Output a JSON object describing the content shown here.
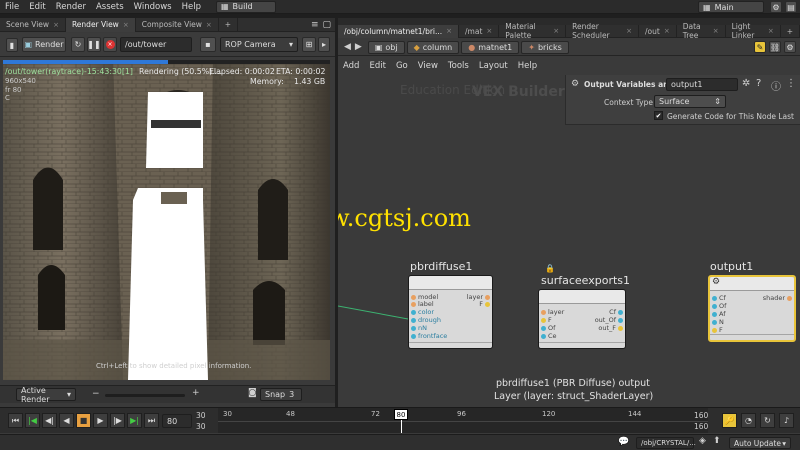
{
  "menubar": {
    "items": [
      "File",
      "Edit",
      "Render",
      "Assets",
      "Windows",
      "Help"
    ],
    "desktop_label": "Build",
    "desktop_right_label": "Main"
  },
  "left_tabs": [
    "Scene View",
    "Render View",
    "Composite View"
  ],
  "render_toolbar": {
    "render_label": "Render",
    "output_path": "/out/tower",
    "camera_label": "ROP Camera"
  },
  "render_info": {
    "node": "/out/tower(raytrace)-15:43:30[1]",
    "status": "Rendering (50.5%)....",
    "elapsed": "Elapsed: 0:00:02",
    "eta": "ETA: 0:00:02",
    "resolution": "960x540",
    "memory_label": "Memory:",
    "memory_value": "1.43 GB",
    "frame": "fr 80",
    "channel": "C",
    "hint": "Ctrl+Left to show detailed pixel information.",
    "progress": 0.505
  },
  "left_bottom": {
    "active_render": "Active Render",
    "snap_label": "Snap",
    "snap_value": "3"
  },
  "right_tabs": [
    "/obj/column/matnet1/bri...",
    "/mat",
    "Material Palette",
    "Render Scheduler",
    "/out",
    "Data Tree",
    "Light Linker"
  ],
  "path_bar": [
    "obj",
    "column",
    "matnet1",
    "bricks"
  ],
  "net_menu": [
    "Add",
    "Edit",
    "Go",
    "View",
    "Tools",
    "Layout",
    "Help"
  ],
  "network": {
    "watermark_edu": "Education Edition",
    "watermark_vex": "VEX Builder",
    "site_watermark": "www.cgtsj.com",
    "caption_line1": "pbrdiffuse1 (PBR Diffuse) output",
    "caption_line2": "Layer (layer: struct_ShaderLayer)"
  },
  "parm_panel": {
    "title": "Output Variables and...",
    "node_name": "output1",
    "context_label": "Context Type",
    "context_value": "Surface",
    "checkbox_label": "Generate Code for This Node Last"
  },
  "nodes": {
    "pbrdiffuse": {
      "title": "pbrdiffuse1",
      "inputs": [
        "model",
        "label",
        "color",
        "drough",
        "nN",
        "frontface"
      ],
      "outputs": [
        "layer",
        "F"
      ]
    },
    "surfaceexports": {
      "title": "surfaceexports1",
      "inputs": [
        "layer",
        "F",
        "Of",
        "Ce"
      ],
      "outputs": [
        "Cf",
        "out_Of",
        "out_F"
      ]
    },
    "output": {
      "title": "output1",
      "inputs": [
        "Cf",
        "Of",
        "Af",
        "N",
        "F"
      ],
      "outputs": [
        "shader"
      ]
    }
  },
  "timeline": {
    "current_frame": "80",
    "start_frame": "30",
    "start_frame2": "30",
    "end_frame": "160",
    "end_frame2": "160",
    "ticks": [
      "30",
      "48",
      "72",
      "96",
      "120",
      "144"
    ],
    "playhead_label": "80"
  },
  "statusbar": {
    "path": "/obj/CRYSTAL/...",
    "auto_update": "Auto Update"
  },
  "colors": {
    "accent": "#2f78d8",
    "node_bg": "#d9d9d9",
    "selected_node": "#e8c43a",
    "wire": "#3cb371"
  }
}
